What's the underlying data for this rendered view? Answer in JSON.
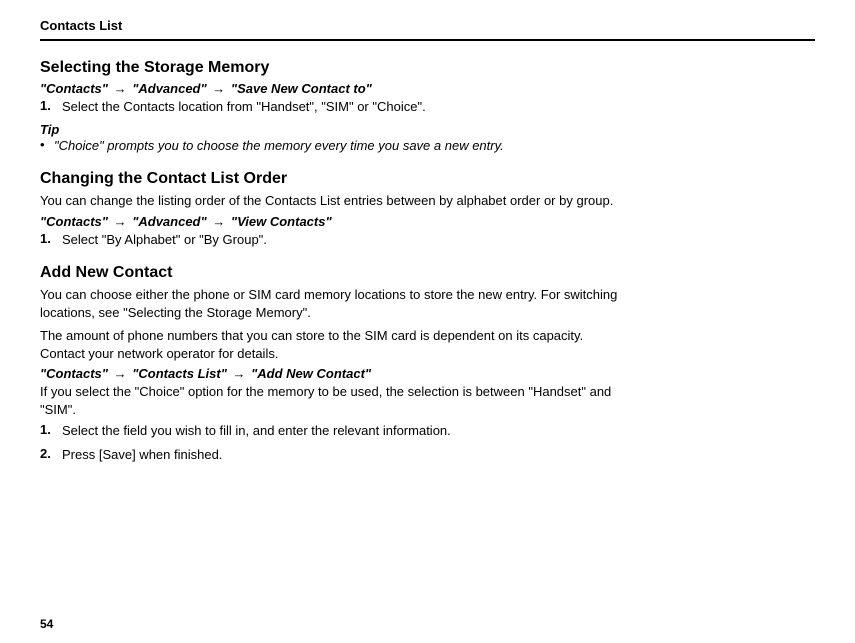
{
  "header": "Contacts List",
  "section1": {
    "title": "Selecting the Storage Memory",
    "bc1": "\"Contacts\"",
    "bc2": "\"Advanced\"",
    "bc3": "\"Save New Contact to\"",
    "step1_num": "1.",
    "step1_text": "Select the Contacts location from \"Handset\", \"SIM\" or \"Choice\".",
    "tip_label": "Tip",
    "tip_bullet": "•",
    "tip_text": "\"Choice\" prompts you to choose the memory every time you save a new entry."
  },
  "section2": {
    "title": "Changing the Contact List Order",
    "intro": "You can change the listing order of the Contacts List entries between by alphabet order or by group.",
    "bc1": "\"Contacts\"",
    "bc2": "\"Advanced\"",
    "bc3": "\"View Contacts\"",
    "step1_num": "1.",
    "step1_text": "Select \"By Alphabet\" or \"By Group\"."
  },
  "section3": {
    "title": "Add New Contact",
    "intro1": "You can choose either the phone or SIM card memory locations to store the new entry. For switching locations, see \"Selecting the Storage Memory\".",
    "intro2": "The amount of phone numbers that you can store to the SIM card is dependent on its capacity. Contact your network operator for details.",
    "bc1": "\"Contacts\"",
    "bc2": "\"Contacts List\"",
    "bc3": "\"Add New Contact\"",
    "note": "If you select the \"Choice\" option for the memory to be used, the selection is between \"Handset\" and \"SIM\".",
    "step1_num": "1.",
    "step1_text": "Select the field you wish to fill in, and enter the relevant information.",
    "step2_num": "2.",
    "step2_text": "Press [Save] when finished."
  },
  "arrow": "→",
  "page_number": "54"
}
